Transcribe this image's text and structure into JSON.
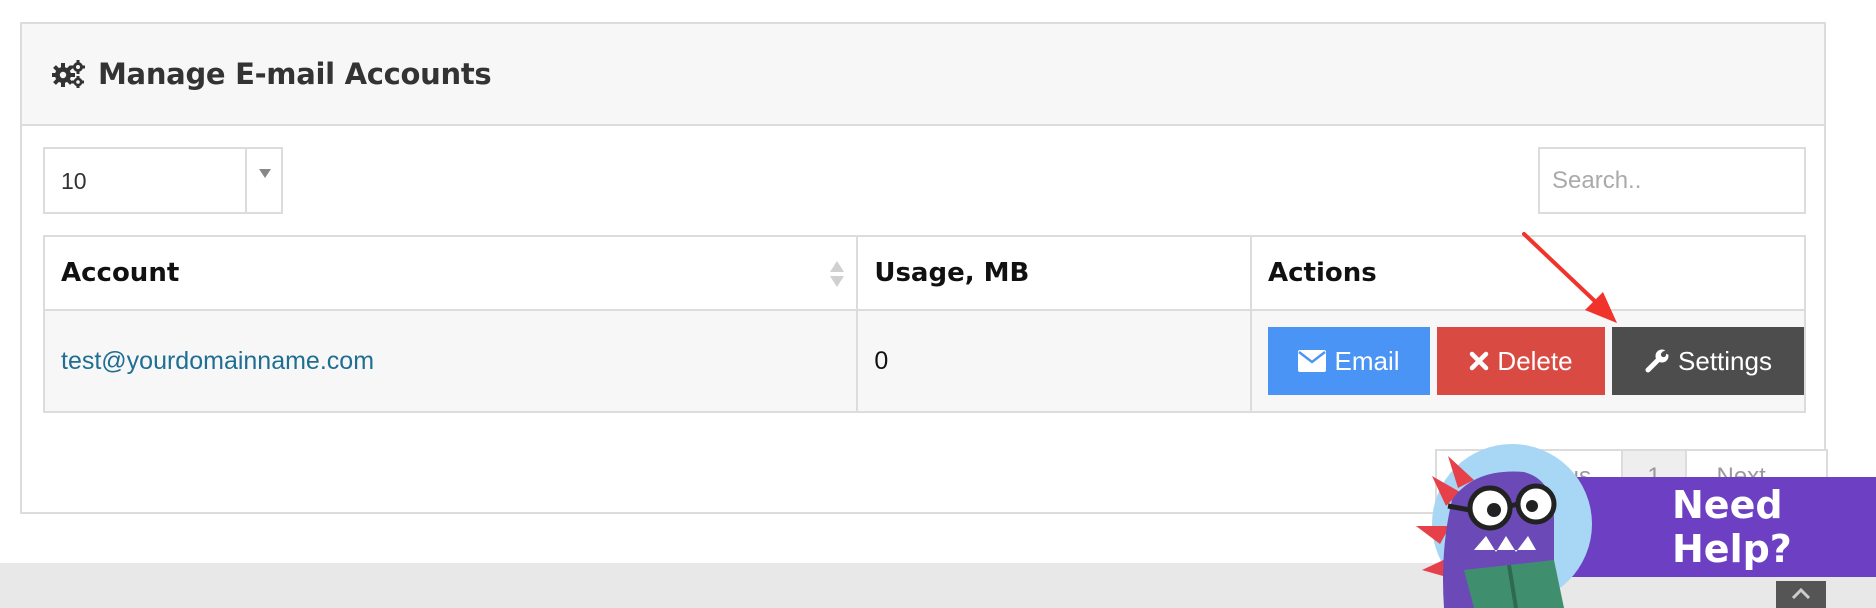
{
  "panel": {
    "title": "Manage E-mail Accounts",
    "title_icon": "gears-icon"
  },
  "page_size": {
    "selected": "10"
  },
  "search": {
    "placeholder": "Search.."
  },
  "table": {
    "headers": {
      "account": "Account",
      "usage": "Usage, MB",
      "actions": "Actions"
    },
    "rows": [
      {
        "account": "test@yourdomainname.com",
        "usage": "0",
        "actions": {
          "email": "Email",
          "delete": "Delete",
          "settings": "Settings"
        }
      }
    ]
  },
  "pagination": {
    "previous": "← Previous",
    "current": "1",
    "next": "Next →"
  },
  "help_widget": {
    "label": "Need Help?"
  },
  "colors": {
    "email_button": "#4a94f5",
    "delete_button": "#d94b42",
    "settings_button": "#4d4d4d",
    "link": "#1f6e93",
    "help_bar": "#6d3fc3",
    "annotation_arrow": "#f0332b"
  }
}
